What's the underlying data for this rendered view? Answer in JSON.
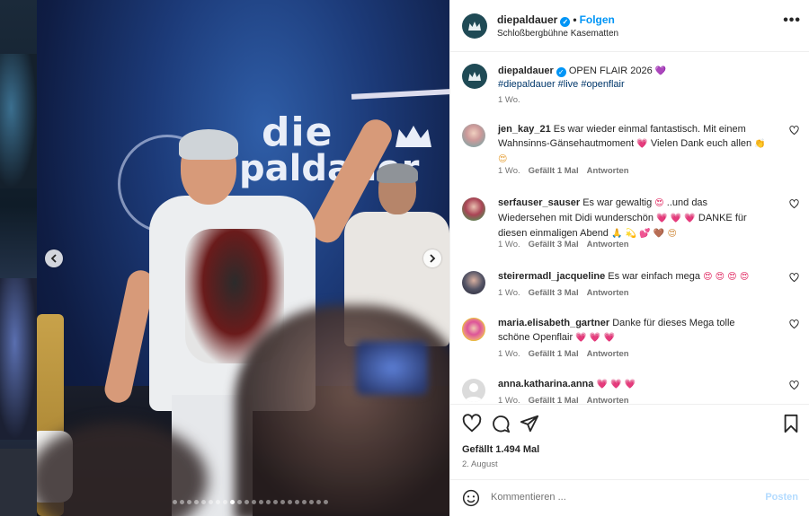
{
  "post": {
    "username": "diepaldauer",
    "follow_label": "Folgen",
    "separator": "•",
    "location": "Schloßbergbühne Kasematten",
    "more_icon": "more-horizontal-icon",
    "image": {
      "carousel_total": 22,
      "carousel_active": 9
    }
  },
  "caption": {
    "username": "diepaldauer",
    "text": "OPEN FLAIR 2026",
    "emoji": "💜",
    "hashtags": "#diepaldauer #live #openflair",
    "time": "1 Wo."
  },
  "comments": [
    {
      "user": "jen_kay_21",
      "text": "Es war wieder einmal fantastisch. Mit einem Wahnsinns-Gänsehautmoment",
      "emoji_mid": "💗",
      "text2": "Vielen Dank euch allen",
      "emoji_end": "👏 😍",
      "time": "1 Wo.",
      "likes": "Gefällt 1 Mal",
      "reply": "Antworten"
    },
    {
      "user": "serfauser_sauser",
      "text": "Es war gewaltig",
      "emoji_mid": "😍",
      "text2": "..und das Wiedersehen mit Didi wunderschön",
      "emoji_mid2": "💗 💗 💗",
      "text3": "DANKE für diesen einmaligen Abend",
      "emoji_end": "🙏 💫 💕 🤎 😍",
      "time": "1 Wo.",
      "likes": "Gefällt 3 Mal",
      "reply": "Antworten"
    },
    {
      "user": "steirermadl_jacqueline",
      "text": "Es war einfach mega",
      "emoji_end": "😍 😍 😍 😍",
      "time": "1 Wo.",
      "likes": "Gefällt 3 Mal",
      "reply": "Antworten"
    },
    {
      "user": "maria.elisabeth_gartner",
      "text": "Danke für dieses Mega tolle schöne Openflair",
      "emoji_end": "💗 💗 💗",
      "time": "1 Wo.",
      "likes": "Gefällt 1 Mal",
      "reply": "Antworten"
    },
    {
      "user": "anna.katharina.anna",
      "text": "",
      "emoji_end": "💗 💗 💗",
      "time": "1 Wo.",
      "likes": "Gefällt 1 Mal",
      "reply": "Antworten"
    }
  ],
  "actions": {
    "like_icon": "heart-icon",
    "comment_icon": "comment-icon",
    "share_icon": "send-icon",
    "save_icon": "bookmark-icon",
    "likes_text": "Gefällt 1.494 Mal",
    "date": "2. August"
  },
  "add_comment": {
    "placeholder": "Kommentieren ...",
    "post_label": "Posten"
  },
  "colors": {
    "accent": "#0095f6",
    "verified": "#0095f6",
    "heart_emoji": "#e0245e",
    "avatar_bg": "#1f4a55"
  },
  "image_overlay": {
    "logo_text_line1": "die",
    "logo_text_line2": "paldauer"
  }
}
